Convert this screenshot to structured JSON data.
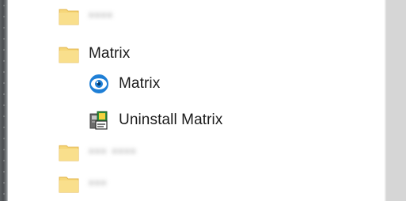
{
  "menu": {
    "items": [
      {
        "kind": "folder",
        "label": "",
        "blurred": "▪▪▪▪",
        "icon": "folder-icon"
      },
      {
        "kind": "folder",
        "label": "Matrix",
        "icon": "folder-icon"
      },
      {
        "kind": "app",
        "label": "Matrix",
        "icon": "matrix-app-icon"
      },
      {
        "kind": "app",
        "label": "Uninstall Matrix",
        "icon": "uninstall-icon"
      },
      {
        "kind": "folder",
        "label": "",
        "blurred": "▪▪▪ ▪▪▪▪",
        "icon": "folder-icon"
      },
      {
        "kind": "folder",
        "label": "",
        "blurred": "▪▪▪",
        "icon": "folder-icon"
      }
    ]
  },
  "colors": {
    "folder": "#f6d77a",
    "folder_dark": "#e8bf4a",
    "scrollbar": "#d6d6d6",
    "text": "#1a1a1a",
    "accent": "#1f7fd6"
  }
}
